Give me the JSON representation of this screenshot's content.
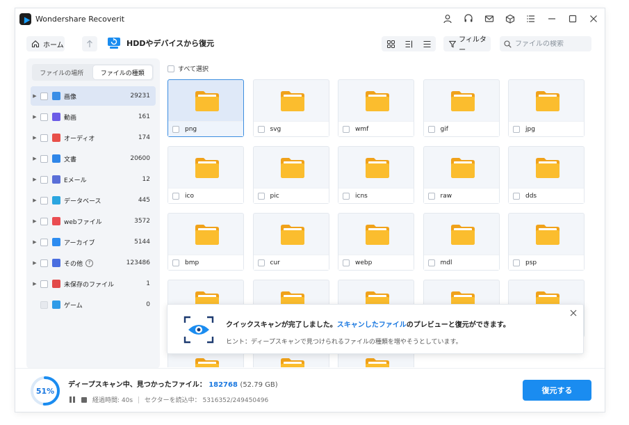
{
  "window": {
    "title": "Wondershare Recoverit",
    "titlebar_icons": [
      "user-icon",
      "headset-icon",
      "mail-icon",
      "box-icon",
      "menu-icon",
      "minimize-icon",
      "maximize-icon",
      "close-icon"
    ]
  },
  "toolbar": {
    "home_label": "ホーム",
    "location_label": "HDDやデバイスから復元",
    "filter_label": "フィルター",
    "search_placeholder": "ファイルの検索"
  },
  "sidebar": {
    "tabs": [
      {
        "label": "ファイルの場所",
        "active": false
      },
      {
        "label": "ファイルの種類",
        "active": true
      }
    ],
    "categories": [
      {
        "name": "画像",
        "count": "29231",
        "icon": "image-icon",
        "color": "#3a8ee6",
        "active": true
      },
      {
        "name": "動画",
        "count": "161",
        "icon": "video-icon",
        "color": "#6c5ce7",
        "active": false
      },
      {
        "name": "オーディオ",
        "count": "174",
        "icon": "audio-icon",
        "color": "#e8504a",
        "active": false
      },
      {
        "name": "文書",
        "count": "20600",
        "icon": "document-icon",
        "color": "#2f86e8",
        "active": false
      },
      {
        "name": "Eメール",
        "count": "12",
        "icon": "email-icon",
        "color": "#5a6fd8",
        "active": false
      },
      {
        "name": "データベース",
        "count": "445",
        "icon": "database-icon",
        "color": "#2ba6e0",
        "active": false
      },
      {
        "name": "webファイル",
        "count": "3572",
        "icon": "web-file-icon",
        "color": "#ea4d52",
        "active": false
      },
      {
        "name": "アーカイブ",
        "count": "5144",
        "icon": "archive-icon",
        "color": "#2d8cf0",
        "active": false
      },
      {
        "name": "その他",
        "count": "123486",
        "icon": "other-icon",
        "color": "#4a6ee0",
        "active": false,
        "help": "?"
      },
      {
        "name": "未保存のファイル",
        "count": "1",
        "icon": "unsaved-file-icon",
        "color": "#e24a4a",
        "active": false
      },
      {
        "name": "ゲーム",
        "count": "0",
        "icon": "game-icon",
        "color": "#2f9be8",
        "active": false,
        "disabled": true
      }
    ]
  },
  "content": {
    "select_all_label": "すべて選択",
    "tiles": [
      {
        "label": "png",
        "selected": true
      },
      {
        "label": "svg"
      },
      {
        "label": "wmf"
      },
      {
        "label": "gif"
      },
      {
        "label": "jpg"
      },
      {
        "label": "ico"
      },
      {
        "label": "pic"
      },
      {
        "label": "icns"
      },
      {
        "label": "raw"
      },
      {
        "label": "dds"
      },
      {
        "label": "bmp"
      },
      {
        "label": "cur"
      },
      {
        "label": "webp"
      },
      {
        "label": "mdl"
      },
      {
        "label": "psp"
      },
      {
        "label": ""
      },
      {
        "label": ""
      },
      {
        "label": ""
      },
      {
        "label": ""
      },
      {
        "label": ""
      },
      {
        "label": ""
      },
      {
        "label": ""
      },
      {
        "label": ""
      }
    ]
  },
  "toast": {
    "message_prefix": "クイックスキャンが完了しました。",
    "message_link": "スキャンしたファイル",
    "message_suffix": "のプレビューと復元ができます。",
    "hint": "ヒント：ディープスキャンで見つけられるファイルの種類を増やそうとしています。"
  },
  "status": {
    "progress_percent": 51,
    "progress_label": "51%",
    "scan_text": "ディープスキャン中、見つかったファイル：",
    "found_count": "182768",
    "found_size": "(52.79 GB)",
    "elapsed": "経過時間: 40s",
    "sectors": "セクターを読込中： 5316352/249450496",
    "recover_label": "復元する"
  },
  "colors": {
    "accent": "#1a8cf0",
    "folder": "#fbbd2e",
    "folder_dark": "#f0a21a"
  }
}
